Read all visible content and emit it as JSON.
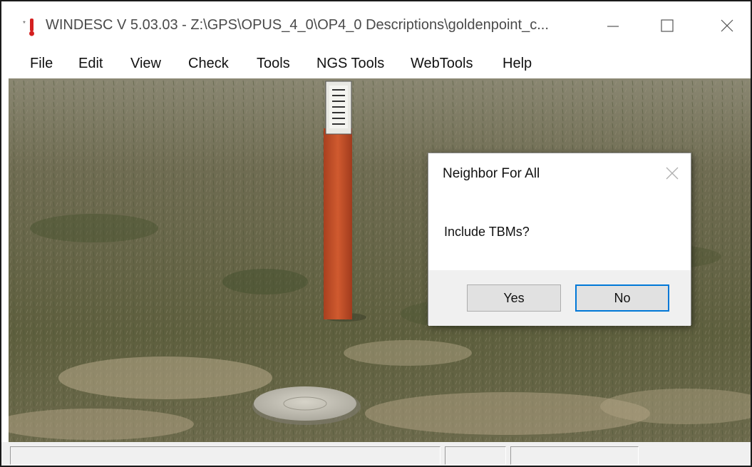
{
  "window": {
    "title": "WINDESC V 5.03.03 - Z:\\GPS\\OPUS_4_0\\OP4_0 Descriptions\\goldenpoint_c...",
    "icon": "thermometer-icon",
    "controls": {
      "minimize": "minimize-icon",
      "maximize": "maximize-icon",
      "close": "close-icon"
    }
  },
  "menu": {
    "items": [
      {
        "label": "File"
      },
      {
        "label": "Edit"
      },
      {
        "label": "View"
      },
      {
        "label": "Check"
      },
      {
        "label": "Tools"
      },
      {
        "label": "NGS Tools"
      },
      {
        "label": "WebTools"
      },
      {
        "label": "Help"
      }
    ]
  },
  "dialog": {
    "title": "Neighbor For All",
    "message": "Include TBMs?",
    "yes_label": "Yes",
    "no_label": "No",
    "default_button": "No"
  },
  "status_bar": {
    "panes": [
      "",
      "",
      ""
    ]
  },
  "colors": {
    "accent": "#0078d7",
    "post": "#c8502a",
    "grass": "#6b6a48"
  }
}
